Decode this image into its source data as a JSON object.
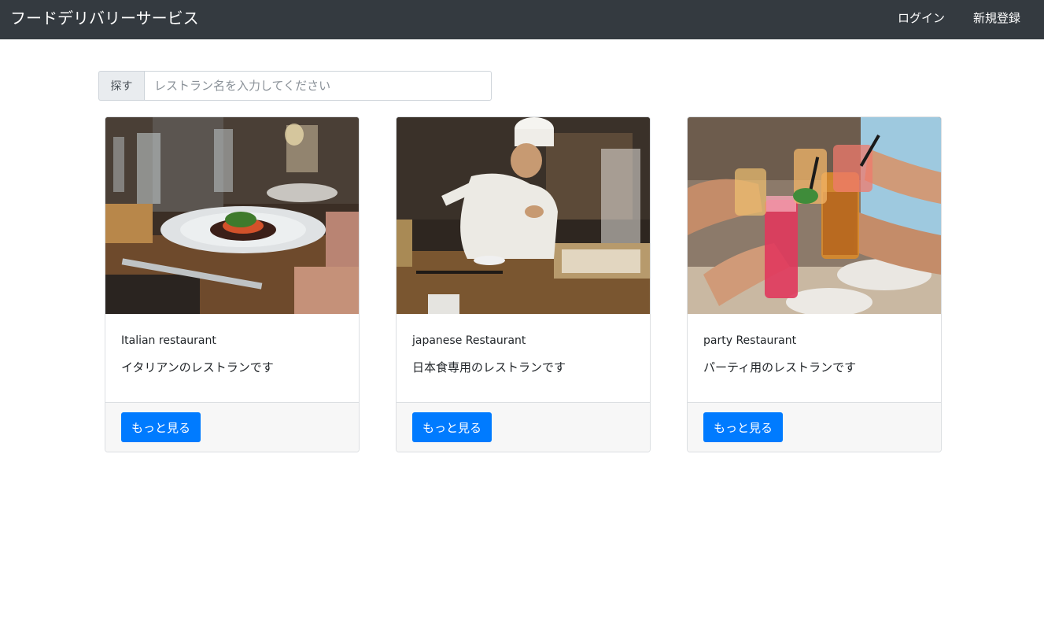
{
  "navbar": {
    "brand": "フードデリバリーサービス",
    "login_label": "ログイン",
    "signup_label": "新規登録",
    "background": "#343a40"
  },
  "search": {
    "addon_label": "探す",
    "placeholder": "レストラン名を入力してください",
    "value": ""
  },
  "cards": [
    {
      "title": "Italian restaurant",
      "text": "イタリアンのレストランです",
      "button_label": "もっと見る",
      "image": "restaurant-table-dish-photo"
    },
    {
      "title": "japanese Restaurant",
      "text": "日本食専用のレストランです",
      "button_label": "もっと見る",
      "image": "sushi-chef-kitchen-photo"
    },
    {
      "title": "party Restaurant",
      "text": "パーティ用のレストランです",
      "button_label": "もっと見る",
      "image": "cocktail-toast-photo"
    }
  ],
  "colors": {
    "primary_button": "#007bff",
    "card_footer": "#f7f7f7"
  }
}
